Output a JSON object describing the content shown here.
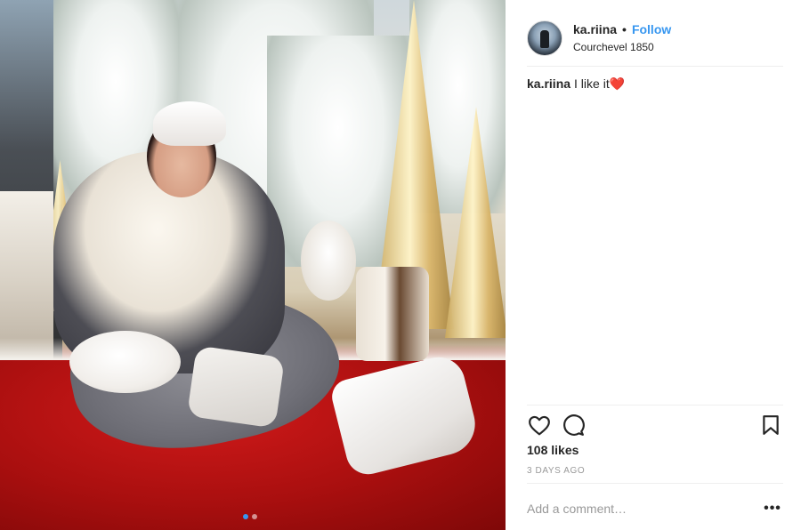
{
  "post": {
    "username": "ka.riina",
    "separator": "•",
    "follow_label": "Follow",
    "location": "Courchevel 1850",
    "caption_user": "ka.riina",
    "caption_text": "I like it",
    "caption_emoji": "❤️",
    "likes": "108 likes",
    "time_ago": "3 DAYS AGO",
    "comment_placeholder": "Add a comment…",
    "more_label": "•••"
  },
  "carousel": {
    "total": 2,
    "active": 1
  },
  "icons": {
    "like": "heart-icon",
    "comment": "comment-bubble-icon",
    "save": "bookmark-icon",
    "more": "more-options-icon"
  },
  "colors": {
    "accent": "#3897f0",
    "text": "#262626",
    "muted": "#999999",
    "divider": "#efefef"
  }
}
